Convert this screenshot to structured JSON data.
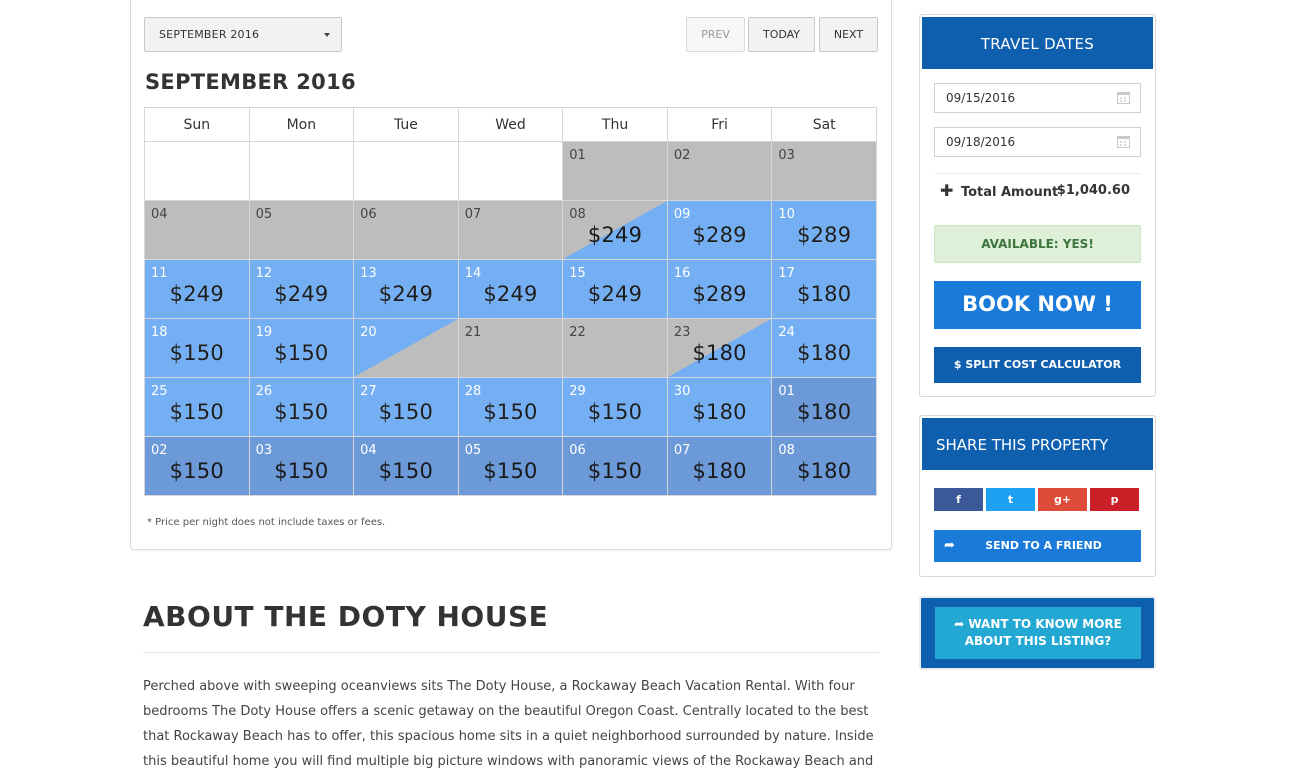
{
  "colors": {
    "unavailable": "#bdbdbd",
    "available": "#74aff3",
    "next_month": "#6c99d8",
    "header_blue": "#0f5faf",
    "button_blue": "#1a7ad9",
    "success_bg": "#dff0d8",
    "success_text": "#3c763d"
  },
  "legend_colors": [
    "#74aff3",
    "#bdbdbd",
    "#74aff3/#bdbdbd",
    "#bdbdbd/#74aff3",
    "#0f5faf/#74aff3",
    "#0f5faf/#bdbdbd"
  ],
  "calendar": {
    "month_select": "SEPTEMBER 2016",
    "prev_label": "PREV",
    "today_label": "TODAY",
    "next_label": "NEXT",
    "title": "SEPTEMBER 2016",
    "weekdays": [
      "Sun",
      "Mon",
      "Tue",
      "Wed",
      "Thu",
      "Fri",
      "Sat"
    ],
    "weeks": [
      [
        {
          "num": "",
          "price": "",
          "status": "empty"
        },
        {
          "num": "",
          "price": "",
          "status": "empty"
        },
        {
          "num": "",
          "price": "",
          "status": "empty"
        },
        {
          "num": "",
          "price": "",
          "status": "empty"
        },
        {
          "num": "01",
          "price": "",
          "status": "unavailable"
        },
        {
          "num": "02",
          "price": "",
          "status": "unavailable"
        },
        {
          "num": "03",
          "price": "",
          "status": "unavailable"
        }
      ],
      [
        {
          "num": "04",
          "price": "",
          "status": "unavailable"
        },
        {
          "num": "05",
          "price": "",
          "status": "unavailable"
        },
        {
          "num": "06",
          "price": "",
          "status": "unavailable"
        },
        {
          "num": "07",
          "price": "",
          "status": "unavailable"
        },
        {
          "num": "08",
          "price": "$249",
          "status": "checkin"
        },
        {
          "num": "09",
          "price": "$289",
          "status": "available"
        },
        {
          "num": "10",
          "price": "$289",
          "status": "available"
        }
      ],
      [
        {
          "num": "11",
          "price": "$249",
          "status": "available"
        },
        {
          "num": "12",
          "price": "$249",
          "status": "available"
        },
        {
          "num": "13",
          "price": "$249",
          "status": "available"
        },
        {
          "num": "14",
          "price": "$249",
          "status": "available"
        },
        {
          "num": "15",
          "price": "$249",
          "status": "available"
        },
        {
          "num": "16",
          "price": "$289",
          "status": "available"
        },
        {
          "num": "17",
          "price": "$180",
          "status": "available"
        }
      ],
      [
        {
          "num": "18",
          "price": "$150",
          "status": "available"
        },
        {
          "num": "19",
          "price": "$150",
          "status": "available"
        },
        {
          "num": "20",
          "price": "",
          "status": "checkout"
        },
        {
          "num": "21",
          "price": "",
          "status": "unavailable"
        },
        {
          "num": "22",
          "price": "",
          "status": "unavailable"
        },
        {
          "num": "23",
          "price": "$180",
          "status": "checkin"
        },
        {
          "num": "24",
          "price": "$180",
          "status": "available"
        }
      ],
      [
        {
          "num": "25",
          "price": "$150",
          "status": "available"
        },
        {
          "num": "26",
          "price": "$150",
          "status": "available"
        },
        {
          "num": "27",
          "price": "$150",
          "status": "available"
        },
        {
          "num": "28",
          "price": "$150",
          "status": "available"
        },
        {
          "num": "29",
          "price": "$150",
          "status": "available"
        },
        {
          "num": "30",
          "price": "$180",
          "status": "available"
        },
        {
          "num": "01",
          "price": "$180",
          "status": "next"
        }
      ],
      [
        {
          "num": "02",
          "price": "$150",
          "status": "next"
        },
        {
          "num": "03",
          "price": "$150",
          "status": "next"
        },
        {
          "num": "04",
          "price": "$150",
          "status": "next"
        },
        {
          "num": "05",
          "price": "$150",
          "status": "next"
        },
        {
          "num": "06",
          "price": "$150",
          "status": "next"
        },
        {
          "num": "07",
          "price": "$180",
          "status": "next"
        },
        {
          "num": "08",
          "price": "$180",
          "status": "next"
        }
      ]
    ],
    "price_note": "* Price per night does not include taxes or fees."
  },
  "about": {
    "title": "ABOUT THE DOTY HOUSE",
    "text": "Perched above with sweeping oceanviews sits The Doty House, a Rockaway Beach Vacation Rental. With four bedrooms The Doty House offers a scenic getaway on the beautiful Oregon Coast. Centrally located to the best that Rockaway Beach has to offer, this spacious home sits in a quiet neighborhood surrounded by nature. Inside this beautiful home you will find multiple big picture windows with panoramic views of the Rockaway Beach and the"
  },
  "travel": {
    "title": "TRAVEL DATES",
    "start_date": "09/15/2016",
    "end_date": "09/18/2016",
    "total_label": "Total Amount",
    "total_amount": "$1,040.60",
    "available_text": "AVAILABLE: YES!",
    "book_label": "BOOK NOW !",
    "split_label": "$ SPLIT COST CALCULATOR"
  },
  "share": {
    "title": "SHARE THIS PROPERTY",
    "facebook": "f",
    "twitter": "t",
    "googleplus": "g+",
    "pinterest": "p",
    "send_label": "SEND TO A FRIEND"
  },
  "more": {
    "line1": "WANT TO KNOW MORE",
    "line2": "ABOUT THIS LISTING?"
  }
}
